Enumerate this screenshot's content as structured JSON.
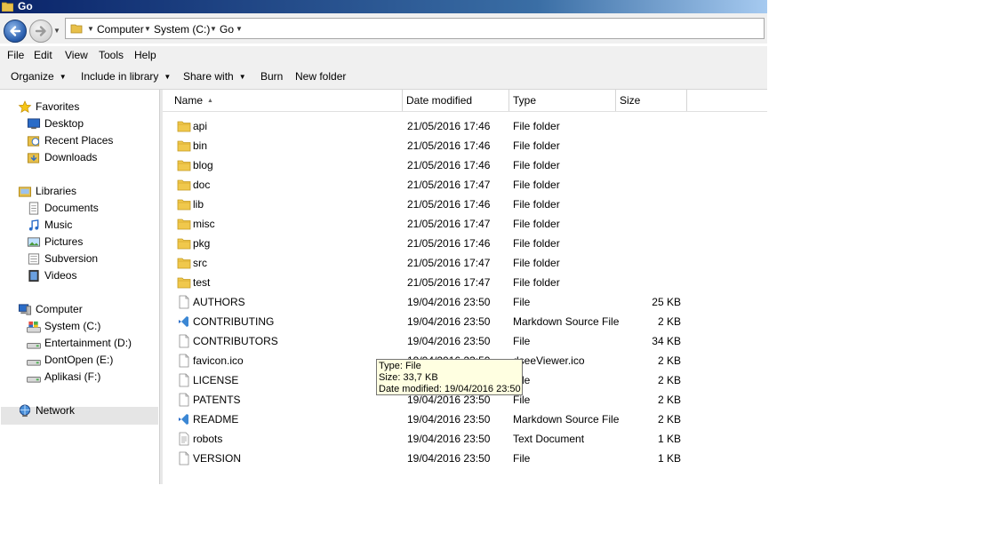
{
  "window": {
    "title": "Go"
  },
  "address": {
    "crumbs": [
      "Computer",
      "System (C:)",
      "Go"
    ]
  },
  "menu": [
    "File",
    "Edit",
    "View",
    "Tools",
    "Help"
  ],
  "commands": {
    "organize": "Organize",
    "include": "Include in library",
    "share": "Share with",
    "burn": "Burn",
    "new_folder": "New folder"
  },
  "nav": {
    "favorites": {
      "label": "Favorites",
      "items": [
        "Desktop",
        "Recent Places",
        "Downloads"
      ]
    },
    "libraries": {
      "label": "Libraries",
      "items": [
        "Documents",
        "Music",
        "Pictures",
        "Subversion",
        "Videos"
      ]
    },
    "computer": {
      "label": "Computer",
      "items": [
        "System (C:)",
        "Entertainment (D:)",
        "DontOpen (E:)",
        "Aplikasi (F:)"
      ]
    },
    "network": {
      "label": "Network"
    },
    "selected": "System (C:)"
  },
  "columns": {
    "name": "Name",
    "date": "Date modified",
    "type": "Type",
    "size": "Size"
  },
  "files": [
    {
      "name": "api",
      "date": "21/05/2016 17:46",
      "type": "File folder",
      "size": "",
      "icon": "folder-icon"
    },
    {
      "name": "bin",
      "date": "21/05/2016 17:46",
      "type": "File folder",
      "size": "",
      "icon": "folder-icon"
    },
    {
      "name": "blog",
      "date": "21/05/2016 17:46",
      "type": "File folder",
      "size": "",
      "icon": "folder-icon"
    },
    {
      "name": "doc",
      "date": "21/05/2016 17:47",
      "type": "File folder",
      "size": "",
      "icon": "folder-icon"
    },
    {
      "name": "lib",
      "date": "21/05/2016 17:46",
      "type": "File folder",
      "size": "",
      "icon": "folder-icon"
    },
    {
      "name": "misc",
      "date": "21/05/2016 17:47",
      "type": "File folder",
      "size": "",
      "icon": "folder-icon"
    },
    {
      "name": "pkg",
      "date": "21/05/2016 17:46",
      "type": "File folder",
      "size": "",
      "icon": "folder-icon"
    },
    {
      "name": "src",
      "date": "21/05/2016 17:47",
      "type": "File folder",
      "size": "",
      "icon": "folder-icon"
    },
    {
      "name": "test",
      "date": "21/05/2016 17:47",
      "type": "File folder",
      "size": "",
      "icon": "folder-icon"
    },
    {
      "name": "AUTHORS",
      "date": "19/04/2016 23:50",
      "type": "File",
      "size": "25 KB",
      "icon": "file-icon"
    },
    {
      "name": "CONTRIBUTING",
      "date": "19/04/2016 23:50",
      "type": "Markdown Source File",
      "size": "2 KB",
      "icon": "vscode-icon"
    },
    {
      "name": "CONTRIBUTORS",
      "date": "19/04/2016 23:50",
      "type": "File",
      "size": "34 KB",
      "icon": "file-icon"
    },
    {
      "name": "favicon.ico",
      "date": "19/04/2016 23:50",
      "type": "dseeViewer.ico",
      "size": "2 KB",
      "icon": "file-icon"
    },
    {
      "name": "LICENSE",
      "date": "19/04/2016 23:50",
      "type": "File",
      "size": "2 KB",
      "icon": "file-icon"
    },
    {
      "name": "PATENTS",
      "date": "19/04/2016 23:50",
      "type": "File",
      "size": "2 KB",
      "icon": "file-icon"
    },
    {
      "name": "README",
      "date": "19/04/2016 23:50",
      "type": "Markdown Source File",
      "size": "2 KB",
      "icon": "vscode-icon"
    },
    {
      "name": "robots",
      "date": "19/04/2016 23:50",
      "type": "Text Document",
      "size": "1 KB",
      "icon": "text-file-icon"
    },
    {
      "name": "VERSION",
      "date": "19/04/2016 23:50",
      "type": "File",
      "size": "1 KB",
      "icon": "file-icon"
    }
  ],
  "tooltip": {
    "type": "Type: File",
    "size": "Size: 33,7 KB",
    "date": "Date modified: 19/04/2016 23:50"
  }
}
